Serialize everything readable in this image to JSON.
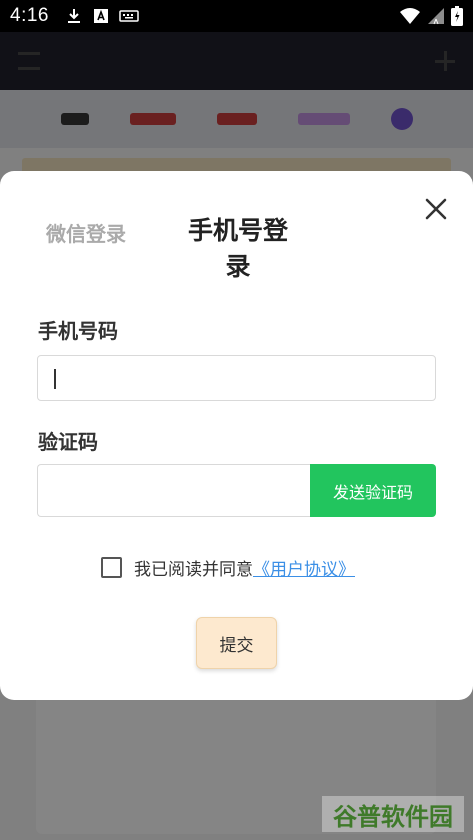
{
  "status_bar": {
    "time": "4:16"
  },
  "modal": {
    "tab_wechat": "微信登录",
    "tab_phone": "手机号登录",
    "phone_label": "手机号码",
    "phone_value": "",
    "code_label": "验证码",
    "code_value": "",
    "send_code": "发送验证码",
    "agree_text": "我已阅读并同意",
    "agreement_link": "《用户协议》",
    "submit": "提交"
  },
  "watermark": "谷普软件园",
  "colors": {
    "accent_green": "#22c55e",
    "link_blue": "#3b8fe6",
    "submit_bg": "#fde9cf"
  }
}
